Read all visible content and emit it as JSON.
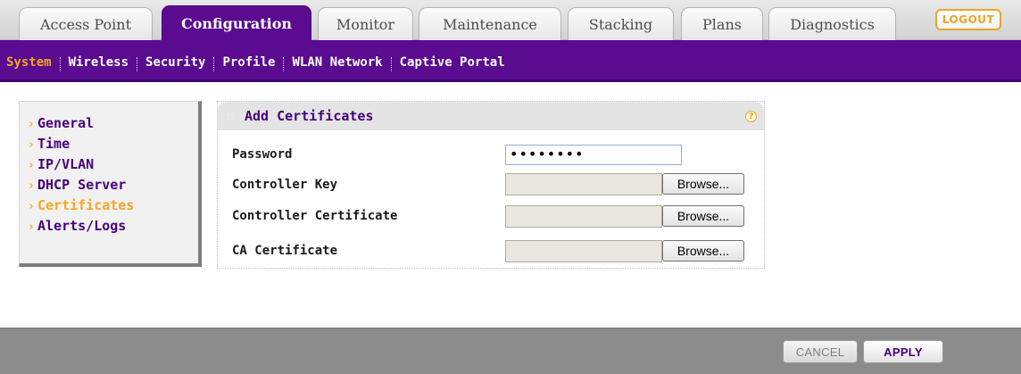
{
  "top_tabs": [
    {
      "label": "Access Point",
      "active": false
    },
    {
      "label": "Configuration",
      "active": true
    },
    {
      "label": "Monitor",
      "active": false
    },
    {
      "label": "Maintenance",
      "active": false
    },
    {
      "label": "Stacking",
      "active": false
    },
    {
      "label": "Plans",
      "active": false
    },
    {
      "label": "Diagnostics",
      "active": false
    }
  ],
  "logout_label": "LOGOUT",
  "sub_nav": [
    {
      "label": "System",
      "active": true
    },
    {
      "label": "Wireless",
      "active": false
    },
    {
      "label": "Security",
      "active": false
    },
    {
      "label": "Profile",
      "active": false
    },
    {
      "label": "WLAN Network",
      "active": false
    },
    {
      "label": "Captive Portal",
      "active": false
    }
  ],
  "side_menu": [
    {
      "label": "General",
      "active": false
    },
    {
      "label": "Time",
      "active": false
    },
    {
      "label": "IP/VLAN",
      "active": false
    },
    {
      "label": "DHCP Server",
      "active": false
    },
    {
      "label": "Certificates",
      "active": true
    },
    {
      "label": "Alerts/Logs",
      "active": false
    }
  ],
  "panel": {
    "title": "Add Certificates",
    "help_icon": "?",
    "password_label": "Password",
    "password_value": "••••••••",
    "controller_key_label": "Controller Key",
    "controller_cert_label": "Controller Certificate",
    "ca_cert_label": "CA Certificate",
    "browse_label": "Browse..."
  },
  "footer": {
    "cancel_label": "CANCEL",
    "apply_label": "APPLY"
  },
  "colors": {
    "brand_purple": "#5a0b90",
    "accent_orange": "#f5a623"
  }
}
